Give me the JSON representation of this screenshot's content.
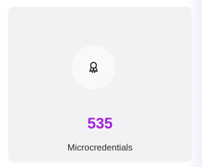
{
  "stat_card": {
    "icon": "award-badge-icon",
    "count": "535",
    "label": "Microcredentials",
    "count_color": "#a020d8"
  }
}
